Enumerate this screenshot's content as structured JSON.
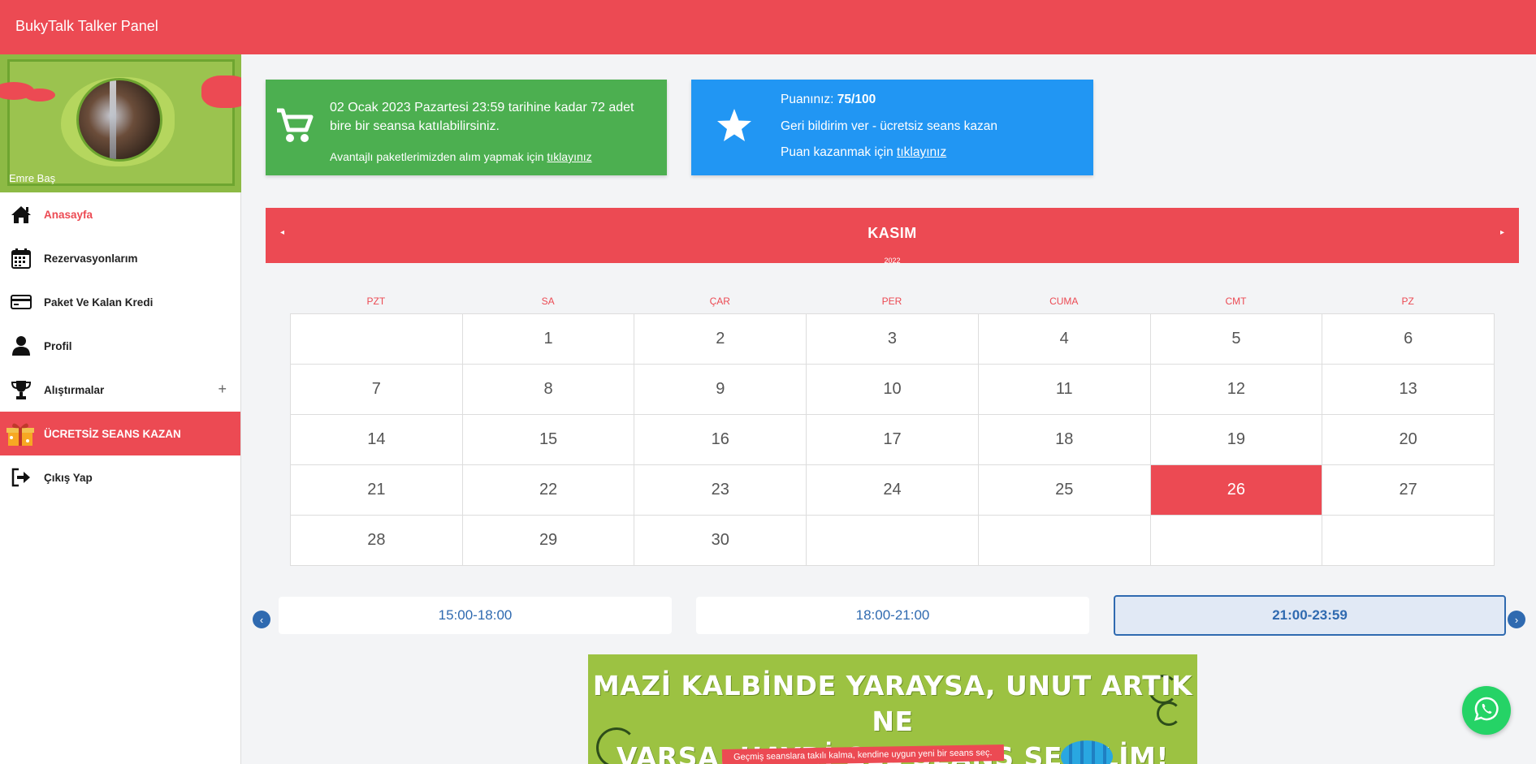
{
  "header": {
    "title": "BukyTalk Talker Panel"
  },
  "profile": {
    "name": "Emre Baş"
  },
  "sidebar": {
    "items": [
      {
        "label": "Anasayfa",
        "icon": "home-icon"
      },
      {
        "label": "Rezervasyonlarım",
        "icon": "calendar-icon"
      },
      {
        "label": "Paket Ve Kalan Kredi",
        "icon": "credit-card-icon"
      },
      {
        "label": "Profil",
        "icon": "user-icon"
      },
      {
        "label": "Alıştırmalar",
        "icon": "trophy-icon",
        "expand": "+"
      },
      {
        "label": "ÜCRETSİZ SEANS KAZAN",
        "icon": "gift-icon"
      },
      {
        "label": "Çıkış Yap",
        "icon": "sign-out-icon"
      }
    ]
  },
  "cards": {
    "sessions": {
      "text": "02 Ocak 2023 Pazartesi 23:59 tarihine kadar 72 adet bire bir seansa katılabilirsiniz.",
      "link_prefix": "Avantajlı paketlerimizden alım yapmak için ",
      "link": "tıklayınız",
      "color": "#4caf50"
    },
    "points": {
      "score_label": "Puanınız: ",
      "score_value": "75/100",
      "feedback": "Geri bildirim ver - ücretsiz seans kazan",
      "link_prefix": "Puan kazanmak için ",
      "link": "tıklayınız",
      "color": "#2196f3"
    }
  },
  "calendar": {
    "month": "KASIM",
    "year": "2022",
    "prev": "◂",
    "next": "▸",
    "weekdays": [
      "PZT",
      "SA",
      "ÇAR",
      "PER",
      "CUMA",
      "CMT",
      "PZ"
    ],
    "cells": [
      "",
      "1",
      "2",
      "3",
      "4",
      "5",
      "6",
      "7",
      "8",
      "9",
      "10",
      "11",
      "12",
      "13",
      "14",
      "15",
      "16",
      "17",
      "18",
      "19",
      "20",
      "21",
      "22",
      "23",
      "24",
      "25",
      "26",
      "27",
      "28",
      "29",
      "30",
      "",
      "",
      "",
      ""
    ],
    "selected": "26",
    "accent": "#ec4a53"
  },
  "slots": {
    "prev": "‹",
    "next": "›",
    "items": [
      "15:00-18:00",
      "18:00-21:00",
      "21:00-23:59"
    ],
    "selected": "21:00-23:59"
  },
  "banner": {
    "headline_1": "MAZİ KALBİNDE YARAYSA, UNUT ARTIK NE",
    "headline_2": "VARSA, HAYDİ GEL SEANS SEÇELİM!",
    "subline": "Geçmiş seanslara takılı kalma, kendine uygun yeni bir seans seç."
  },
  "whatsapp": {
    "icon": "whatsapp-icon"
  }
}
